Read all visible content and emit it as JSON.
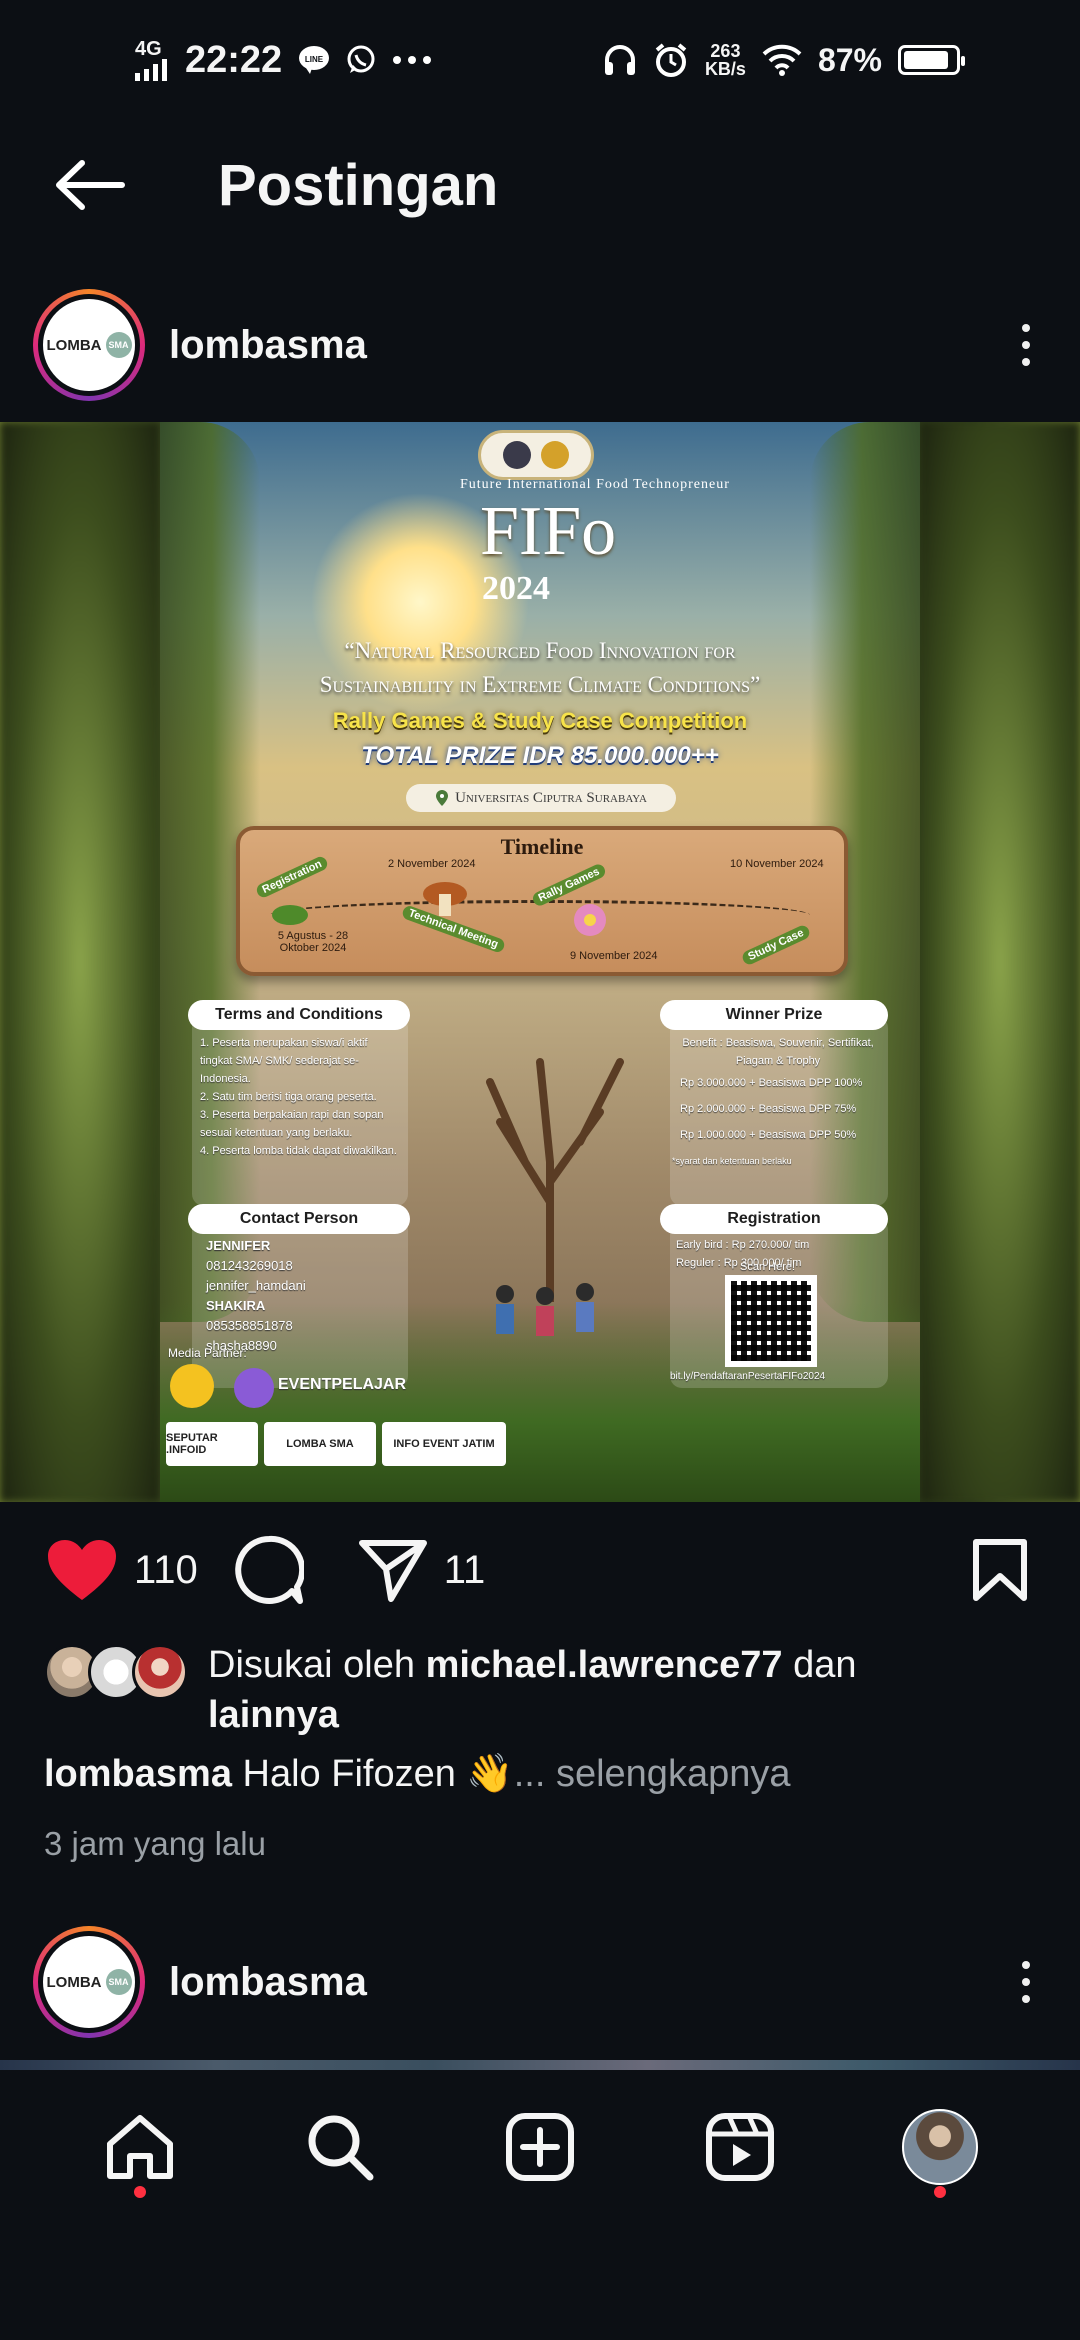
{
  "status_bar": {
    "network": "4G",
    "time": "22:22",
    "speed_value": "263",
    "speed_unit": "KB/s",
    "battery_percent": "87%",
    "battery_level": 0.87
  },
  "header": {
    "title": "Postingan"
  },
  "post": {
    "username": "lombasma",
    "avatar_logo_text": "LOMBA",
    "avatar_badge_text": "SMA",
    "image": {
      "arc_title": "Future International Food Technopreneur",
      "title": "FIFo",
      "year": "2024",
      "theme_line1": "“Natural Resourced Food Innovation for",
      "theme_line2": "Sustainability in Extreme Climate Conditions”",
      "competition": "Rally Games & Study Case Competition",
      "prize": "TOTAL PRIZE IDR 85.000.000++",
      "location": "Universitas Ciputra Surabaya",
      "timeline": {
        "title": "Timeline",
        "reg_label": "Registration",
        "reg_dates": "5 Agustus - 28 Oktober 2024",
        "tm_date": "2 November 2024",
        "tm_label": "Technical Meeting",
        "rally_label": "Rally Games",
        "rally_date": "9 November 2024",
        "study_date": "10 November 2024",
        "study_label": "Study Case"
      },
      "terms": {
        "title": "Terms and Conditions",
        "items": [
          "1. Peserta merupakan siswa/i aktif tingkat SMA/ SMK/ sederajat se-Indonesia.",
          "2. Satu tim berisi tiga orang peserta.",
          "3. Peserta berpakaian rapi dan sopan sesuai ketentuan yang berlaku.",
          "4. Peserta lomba tidak dapat diwakilkan."
        ]
      },
      "prize_panel": {
        "title": "Winner Prize",
        "benefit": "Benefit : Beasiswa, Souvenir, Sertifikat, Piagam & Trophy",
        "first": "Rp 3.000.000 + Beasiswa DPP 100%",
        "second": "Rp 2.000.000 + Beasiswa DPP 75%",
        "third": "Rp 1.000.000 + Beasiswa DPP 50%",
        "note": "*syarat dan ketentuan berlaku"
      },
      "contact": {
        "title": "Contact Person",
        "name1": "JENNIFER",
        "wa1": "081243269018",
        "line1": "jennifer_hamdani",
        "name2": "SHAKIRA",
        "wa2": "085358851878",
        "line2": "shasha8890"
      },
      "registration": {
        "title": "Registration",
        "early_label": "Early bird",
        "early_price": ": Rp 270.000/ tim",
        "regular_label": "Reguler",
        "regular_price": ": Rp 300.000/ tim",
        "scan": "Scan Here!",
        "link": "bit.ly/PendaftaranPesertaFIFo2024"
      },
      "media_partner_label": "Media Partner:",
      "partner_event_pelajar": "EVENTPELAJAR",
      "partner_seputar": "SEPUTAR .INFOID",
      "partner_lomba_sma": "LOMBA SMA",
      "partner_info_event": "INFO EVENT JATIM"
    },
    "like_count": "110",
    "share_count": "11",
    "liked_by_prefix": "Disukai oleh ",
    "liked_by_user": "michael.lawrence77",
    "liked_by_join": " dan",
    "liked_by_others": "lainnya",
    "caption_user": "lombasma",
    "caption_text": " Halo Fifozen 👋",
    "caption_more": "... selengkapnya",
    "timestamp": "3 jam yang lalu"
  },
  "next_post": {
    "username": "lombasma"
  },
  "colors": {
    "like_red": "#ed1c3a",
    "background": "#0c0f14",
    "muted_text": "#9aa0a6",
    "notification_dot": "#ff3040"
  },
  "bottom_nav": [
    {
      "icon": "home-icon"
    },
    {
      "icon": "search-icon"
    },
    {
      "icon": "create-icon"
    },
    {
      "icon": "reels-icon"
    },
    {
      "icon": "profile-avatar"
    }
  ]
}
